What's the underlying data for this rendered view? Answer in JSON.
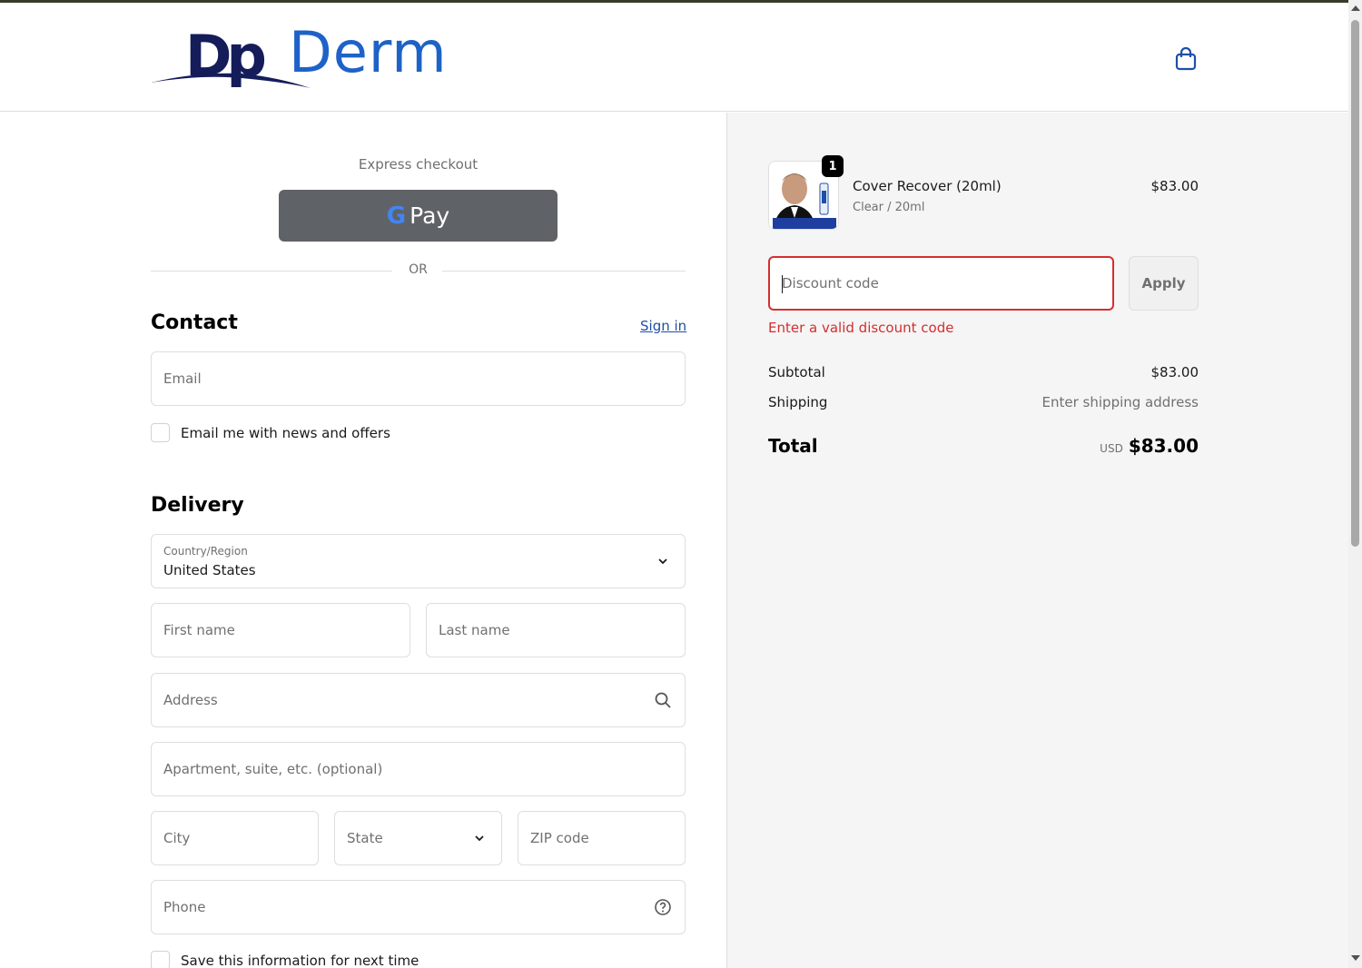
{
  "brand": {
    "logo_mark": "Dp",
    "logo_text": "Derm",
    "logo_dark": "#141c5a",
    "logo_blue": "#1e62c8"
  },
  "header": {
    "cart_icon": "shopping-bag-icon"
  },
  "express": {
    "label": "Express checkout",
    "gpay_label": "Pay",
    "separator": "OR"
  },
  "contact": {
    "title": "Contact",
    "sign_in": "Sign in",
    "email_placeholder": "Email",
    "newsletter_label": "Email me with news and offers"
  },
  "delivery": {
    "title": "Delivery",
    "country_label": "Country/Region",
    "country_value": "United States",
    "first_name": "First name",
    "last_name": "Last name",
    "address": "Address",
    "apartment": "Apartment, suite, etc. (optional)",
    "city": "City",
    "state": "State",
    "zip": "ZIP code",
    "phone": "Phone",
    "save_info": "Save this information for next time"
  },
  "order": {
    "item": {
      "name": "Cover Recover (20ml)",
      "variant": "Clear / 20ml",
      "price": "$83.00",
      "quantity": "1"
    },
    "discount": {
      "placeholder": "Discount code",
      "apply": "Apply",
      "error": "Enter a valid discount code"
    },
    "subtotal_label": "Subtotal",
    "subtotal_value": "$83.00",
    "shipping_label": "Shipping",
    "shipping_value": "Enter shipping address",
    "total_label": "Total",
    "total_currency": "USD",
    "total_value": "$83.00"
  },
  "colors": {
    "error": "#d32f2f",
    "link": "#1e4fa8",
    "gpay_bg": "#5f6368"
  }
}
